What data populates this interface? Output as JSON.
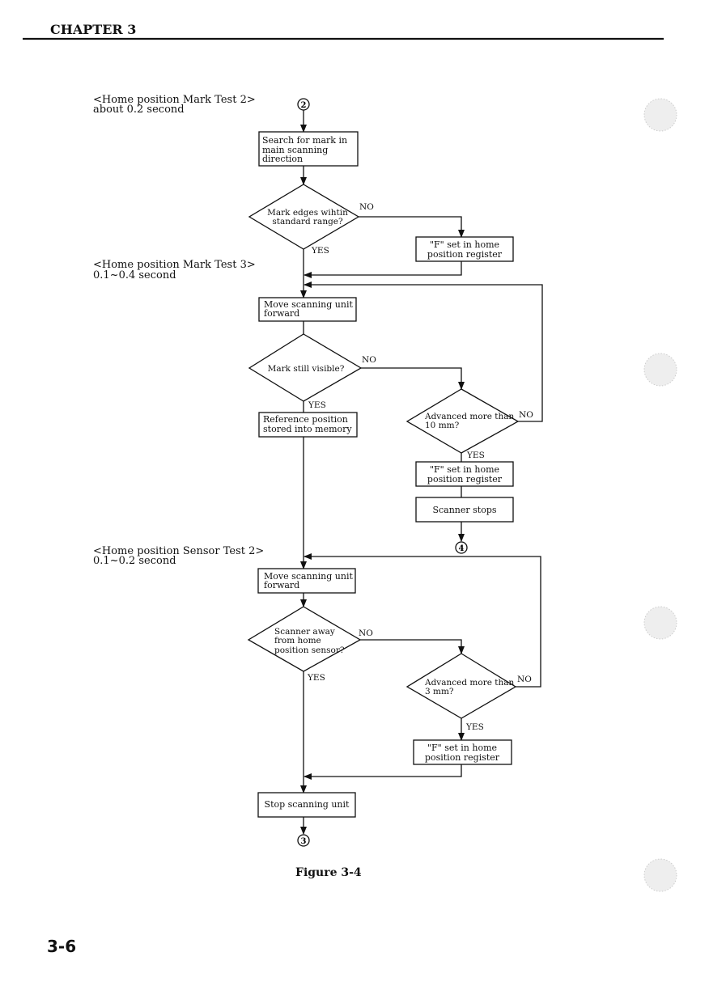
{
  "header": {
    "chapter": "CHAPTER 3"
  },
  "labels": {
    "mark_test_2": [
      "<Home position Mark Test 2>",
      "about 0.2 second"
    ],
    "mark_test_3": [
      "<Home position Mark Test 3>",
      "0.1~0.4 second"
    ],
    "sensor_test_2": [
      "<Home position Sensor Test 2>",
      "0.1~0.2 second"
    ]
  },
  "flow": {
    "connector_start": "2",
    "search_box": [
      "Search for mark in",
      "main scanning",
      "direction"
    ],
    "decision_edges": [
      "Mark edges wihtin",
      "standard range?"
    ],
    "f_set_1": [
      "\"F\" set in home",
      "position register"
    ],
    "move_forward_1": [
      "Move scanning unit",
      "forward"
    ],
    "decision_visible": "Mark still visible?",
    "reference_box": [
      "Reference position",
      "stored into memory"
    ],
    "decision_10mm": [
      "Advanced more than",
      "10 mm?"
    ],
    "f_set_2": [
      "\"F\" set in home",
      "position register"
    ],
    "scanner_stops": "Scanner stops",
    "connector_4": "4",
    "move_forward_2": [
      "Move scanning unit",
      "forward"
    ],
    "decision_away": [
      "Scanner away",
      "from home",
      "position sensor?"
    ],
    "decision_3mm": [
      "Advanced more than",
      "3 mm?"
    ],
    "f_set_3": [
      "\"F\" set in home",
      "position register"
    ],
    "stop_box": "Stop scanning unit",
    "connector_end": "3",
    "yes": "YES",
    "no": "NO"
  },
  "figure_caption": "Figure 3-4",
  "page_number": "3-6"
}
